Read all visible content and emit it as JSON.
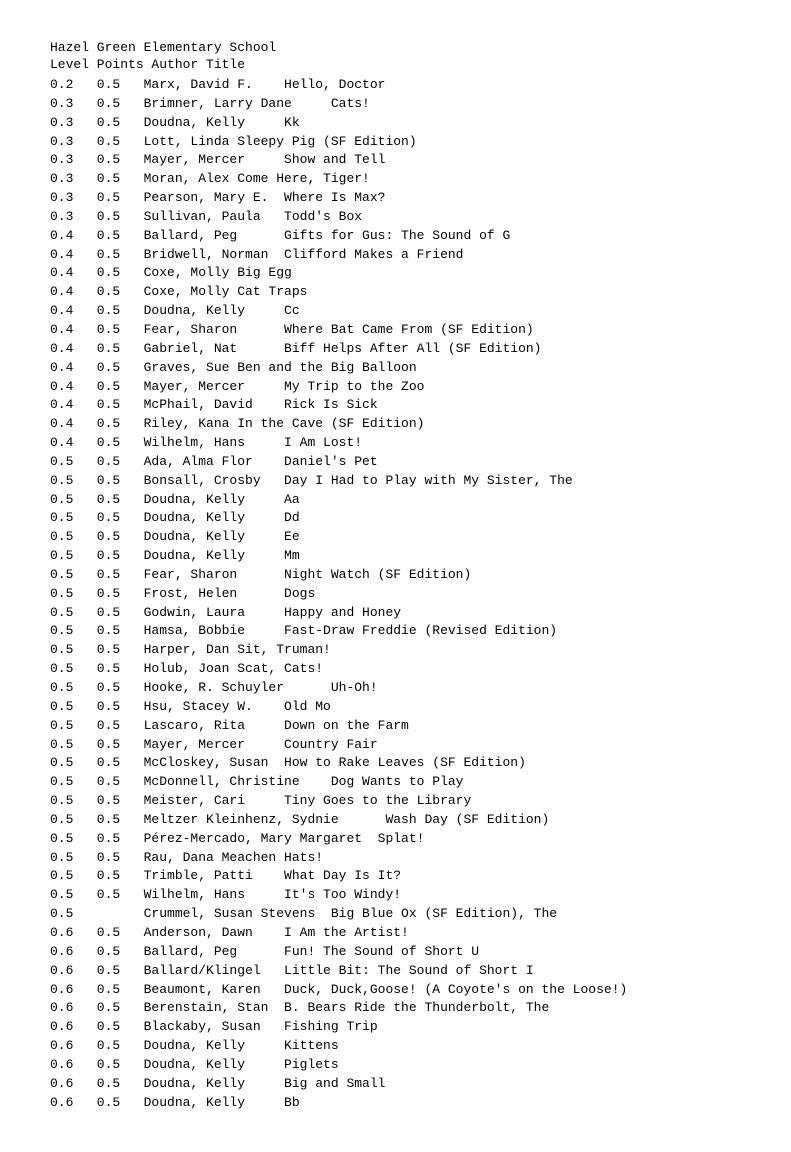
{
  "school": "Hazel Green Elementary School",
  "header": "Level Points      Author        Title",
  "rows": [
    "0.2   0.5   Marx, David F.    Hello, Doctor",
    "0.3   0.5   Brimner, Larry Dane     Cats!",
    "0.3   0.5   Doudna, Kelly     Kk",
    "0.3   0.5   Lott, Linda Sleepy Pig (SF Edition)",
    "0.3   0.5   Mayer, Mercer     Show and Tell",
    "0.3   0.5   Moran, Alex Come Here, Tiger!",
    "0.3   0.5   Pearson, Mary E.  Where Is Max?",
    "0.3   0.5   Sullivan, Paula   Todd's Box",
    "0.4   0.5   Ballard, Peg      Gifts for Gus: The Sound of G",
    "0.4   0.5   Bridwell, Norman  Clifford Makes a Friend",
    "0.4   0.5   Coxe, Molly Big Egg",
    "0.4   0.5   Coxe, Molly Cat Traps",
    "0.4   0.5   Doudna, Kelly     Cc",
    "0.4   0.5   Fear, Sharon      Where Bat Came From (SF Edition)",
    "0.4   0.5   Gabriel, Nat      Biff Helps After All (SF Edition)",
    "0.4   0.5   Graves, Sue Ben and the Big Balloon",
    "0.4   0.5   Mayer, Mercer     My Trip to the Zoo",
    "0.4   0.5   McPhail, David    Rick Is Sick",
    "0.4   0.5   Riley, Kana In the Cave (SF Edition)",
    "0.4   0.5   Wilhelm, Hans     I Am Lost!",
    "0.5   0.5   Ada, Alma Flor    Daniel's Pet",
    "0.5   0.5   Bonsall, Crosby   Day I Had to Play with My Sister, The",
    "0.5   0.5   Doudna, Kelly     Aa",
    "0.5   0.5   Doudna, Kelly     Dd",
    "0.5   0.5   Doudna, Kelly     Ee",
    "0.5   0.5   Doudna, Kelly     Mm",
    "0.5   0.5   Fear, Sharon      Night Watch (SF Edition)",
    "0.5   0.5   Frost, Helen      Dogs",
    "0.5   0.5   Godwin, Laura     Happy and Honey",
    "0.5   0.5   Hamsa, Bobbie     Fast-Draw Freddie (Revised Edition)",
    "0.5   0.5   Harper, Dan Sit, Truman!",
    "0.5   0.5   Holub, Joan Scat, Cats!",
    "0.5   0.5   Hooke, R. Schuyler      Uh-Oh!",
    "0.5   0.5   Hsu, Stacey W.    Old Mo",
    "0.5   0.5   Lascaro, Rita     Down on the Farm",
    "0.5   0.5   Mayer, Mercer     Country Fair",
    "0.5   0.5   McCloskey, Susan  How to Rake Leaves (SF Edition)",
    "0.5   0.5   McDonnell, Christine    Dog Wants to Play",
    "0.5   0.5   Meister, Cari     Tiny Goes to the Library",
    "0.5   0.5   Meltzer Kleinhenz, Sydnie      Wash Day (SF Edition)",
    "0.5   0.5   Pérez-Mercado, Mary Margaret  Splat!",
    "0.5   0.5   Rau, Dana Meachen Hats!",
    "0.5   0.5   Trimble, Patti    What Day Is It?",
    "0.5   0.5   Wilhelm, Hans     It's Too Windy!",
    "0.5         Crummel, Susan Stevens  Big Blue Ox (SF Edition), The",
    "0.6   0.5   Anderson, Dawn    I Am the Artist!",
    "0.6   0.5   Ballard, Peg      Fun! The Sound of Short U",
    "0.6   0.5   Ballard/Klingel   Little Bit: The Sound of Short I",
    "0.6   0.5   Beaumont, Karen   Duck, Duck,Goose! (A Coyote's on the Loose!)",
    "0.6   0.5   Berenstain, Stan  B. Bears Ride the Thunderbolt, The",
    "0.6   0.5   Blackaby, Susan   Fishing Trip",
    "0.6   0.5   Doudna, Kelly     Kittens",
    "0.6   0.5   Doudna, Kelly     Piglets",
    "0.6   0.5   Doudna, Kelly     Big and Small",
    "0.6   0.5   Doudna, Kelly     Bb"
  ]
}
